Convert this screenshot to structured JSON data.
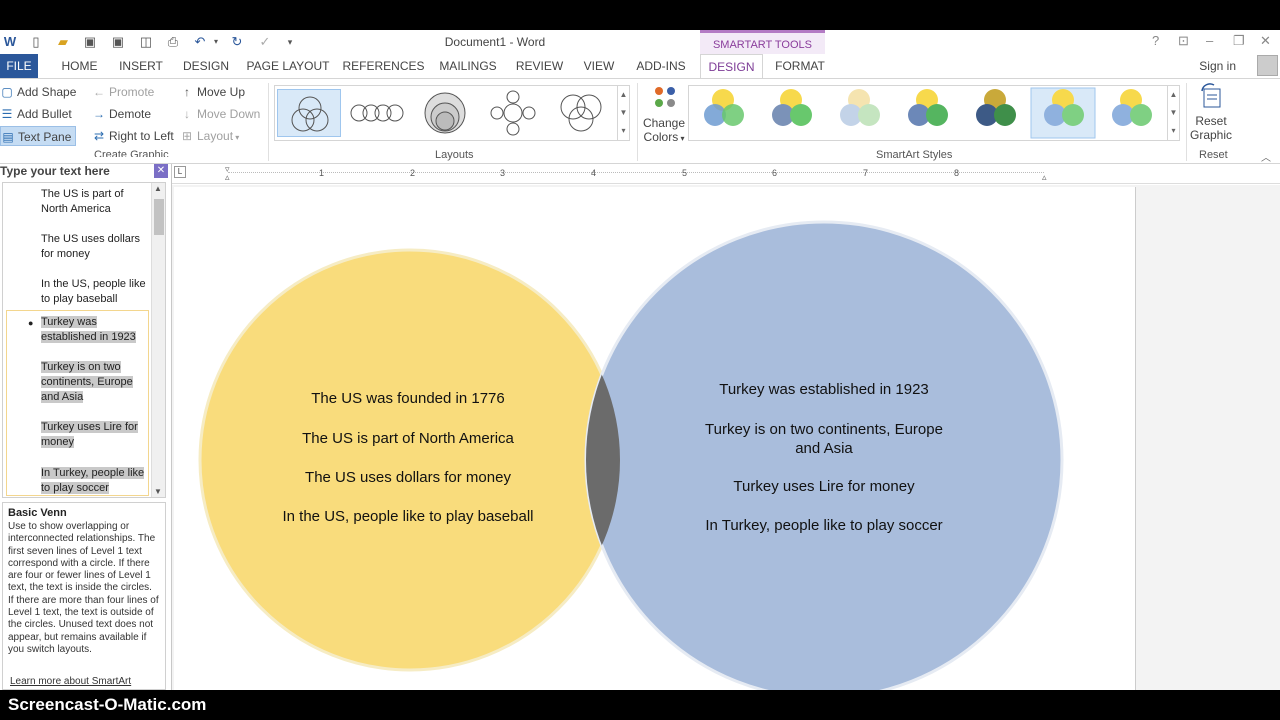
{
  "title_bar": {
    "document_title": "Document1 - Word",
    "contextual_group": "SMARTART TOOLS"
  },
  "tabs": [
    {
      "label": "FILE"
    },
    {
      "label": "HOME"
    },
    {
      "label": "INSERT"
    },
    {
      "label": "DESIGN"
    },
    {
      "label": "PAGE LAYOUT"
    },
    {
      "label": "REFERENCES"
    },
    {
      "label": "MAILINGS"
    },
    {
      "label": "REVIEW"
    },
    {
      "label": "VIEW"
    },
    {
      "label": "ADD-INS"
    },
    {
      "label": "DESIGN"
    },
    {
      "label": "FORMAT"
    }
  ],
  "signin_label": "Sign in",
  "ribbon": {
    "create_graphic": {
      "add_shape": "Add Shape",
      "add_bullet": "Add Bullet",
      "text_pane": "Text Pane",
      "promote": "Promote",
      "demote": "Demote",
      "right_to_left": "Right to Left",
      "move_up": "Move Up",
      "move_down": "Move Down",
      "layout": "Layout",
      "group_label": "Create Graphic"
    },
    "layouts_label": "Layouts",
    "change_colors_line1": "Change",
    "change_colors_line2": "Colors",
    "smartart_styles_label": "SmartArt Styles",
    "reset_graphic_line1": "Reset",
    "reset_graphic_line2": "Graphic",
    "reset_label": "Reset"
  },
  "text_pane": {
    "title": "Type your text here",
    "items": [
      {
        "text": "The US is part of North America"
      },
      {
        "text": "The US uses dollars for money"
      },
      {
        "text": "In the US, people like to play baseball"
      },
      {
        "text": "Turkey was established in 1923"
      },
      {
        "text": "Turkey is on two continents, Europe and Asia"
      },
      {
        "text": "Turkey uses Lire for money"
      },
      {
        "text": "In Turkey, people like to play soccer"
      }
    ],
    "desc_title": "Basic Venn",
    "desc_body": "Use to show overlapping or interconnected relationships. The first seven lines of Level 1 text correspond with a circle. If there are four or fewer lines of Level 1 text, the text is inside the circles. If there are more than four lines of Level 1 text, the text is outside of the circles. Unused text does not appear, but remains available if you switch layouts.",
    "learn_more": "Learn more about SmartArt"
  },
  "ruler_numbers": [
    "1",
    "2",
    "3",
    "4",
    "5",
    "6",
    "7",
    "8"
  ],
  "venn": {
    "left_lines": [
      "The US was founded in 1776",
      "The US is part of North America",
      "The US uses dollars for money",
      "In the US, people like to play baseball"
    ],
    "right_lines": [
      "Turkey was established in 1923",
      "Turkey is on two continents, Europe",
      "and Asia",
      "Turkey uses Lire for money",
      "In Turkey, people like to play soccer"
    ],
    "left_color": "#f9dc7c",
    "right_color": "#a9bddc",
    "overlap_color": "#6b6b6b"
  },
  "watermark": "Screencast-O-Matic.com",
  "colors": {
    "file_tab": "#2b579a",
    "contextual_accent": "#8a3d9c"
  }
}
